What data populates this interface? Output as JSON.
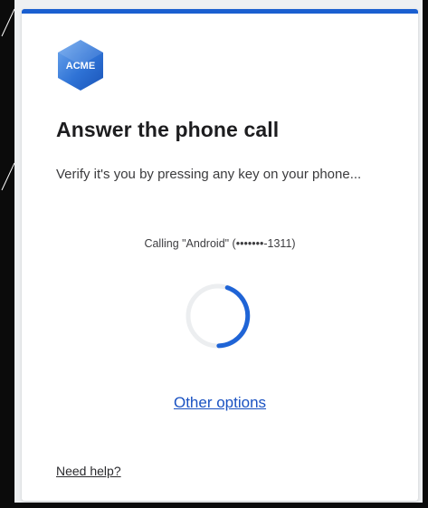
{
  "brand": {
    "logo_text": "ACME",
    "accent_color": "#1a5fd0"
  },
  "header": {
    "title": "Answer the phone call",
    "subtitle": "Verify it's you by pressing any key on your phone..."
  },
  "call": {
    "status_text": "Calling \"Android\" (•••••••-1311)"
  },
  "spinner": {
    "icon": "loading-spinner-icon",
    "track_color": "#eceef0",
    "arc_color": "#1f64d6"
  },
  "links": {
    "other_options": "Other options",
    "need_help": "Need help?"
  }
}
